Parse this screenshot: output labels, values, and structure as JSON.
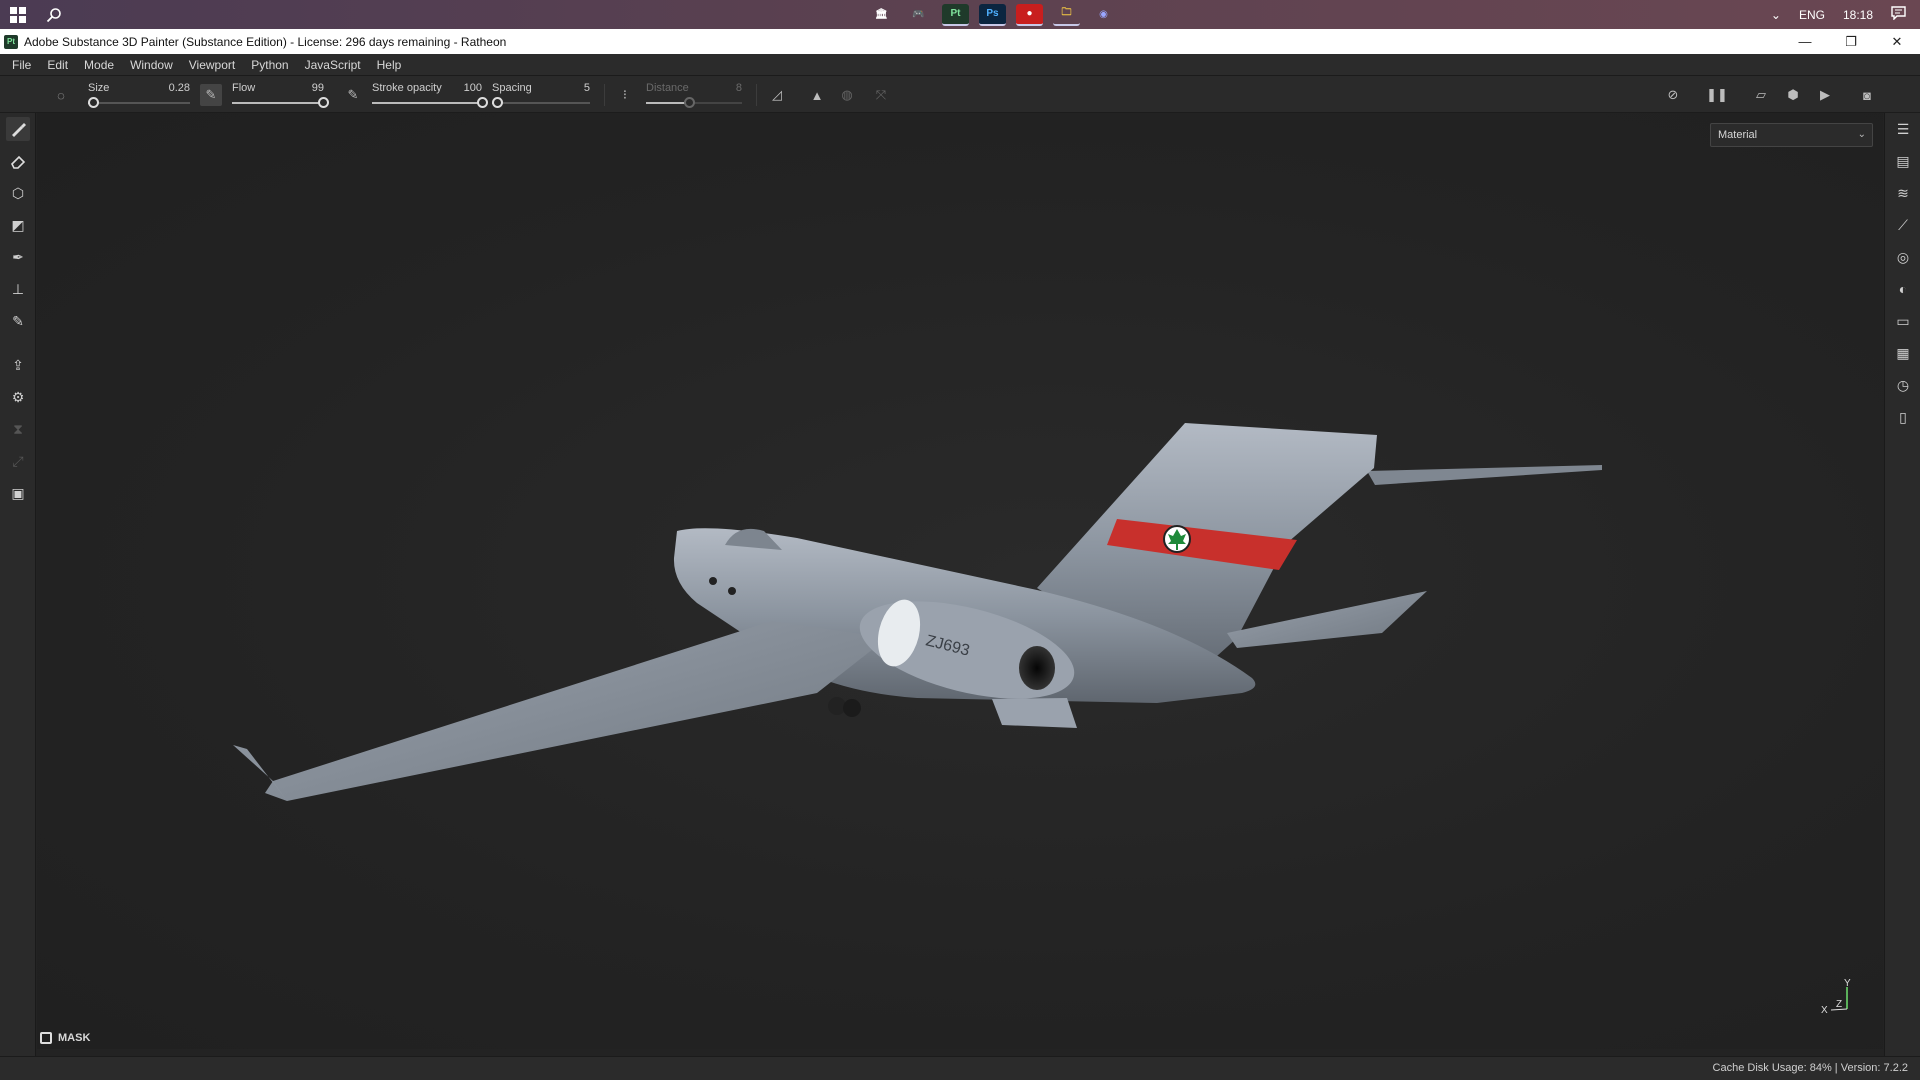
{
  "taskbar": {
    "time": "18:18",
    "language": "ENG",
    "apps": [
      {
        "name": "bank-app-icon",
        "label": "🏛"
      },
      {
        "name": "gamepad-app-icon",
        "label": "🎮"
      },
      {
        "name": "substance-painter-app-icon",
        "label": "Pt"
      },
      {
        "name": "photoshop-app-icon",
        "label": "Ps"
      },
      {
        "name": "recorder-app-icon",
        "label": "●"
      },
      {
        "name": "file-explorer-app-icon",
        "label": "🗀"
      },
      {
        "name": "discord-app-icon",
        "label": "◉"
      }
    ]
  },
  "window": {
    "title": "Adobe Substance 3D Painter (Substance Edition) - License: 296 days remaining - Ratheon",
    "logo": "Pt"
  },
  "menu": [
    "File",
    "Edit",
    "Mode",
    "Window",
    "Viewport",
    "Python",
    "JavaScript",
    "Help"
  ],
  "tool_options": {
    "size": {
      "label": "Size",
      "value": "0.28",
      "fraction": 0.05
    },
    "flow": {
      "label": "Flow",
      "value": "99",
      "fraction": 0.99
    },
    "stroke_opacity": {
      "label": "Stroke opacity",
      "value": "100",
      "fraction": 1.0
    },
    "spacing": {
      "label": "Spacing",
      "value": "5",
      "fraction": 0.05
    },
    "distance": {
      "label": "Distance",
      "value": "8",
      "fraction": 0.45
    }
  },
  "viewport": {
    "channel": "Material",
    "mask_label": "MASK",
    "aircraft_registration": "ZJ693",
    "axes": {
      "x": "X",
      "y": "Y",
      "z": "Z"
    }
  },
  "status": {
    "text": "Cache Disk Usage:   84% | Version: 7.2.2"
  },
  "colors": {
    "accent_stripe": "#c8302c",
    "fuselage": "#8b949f",
    "background": "#232323"
  }
}
